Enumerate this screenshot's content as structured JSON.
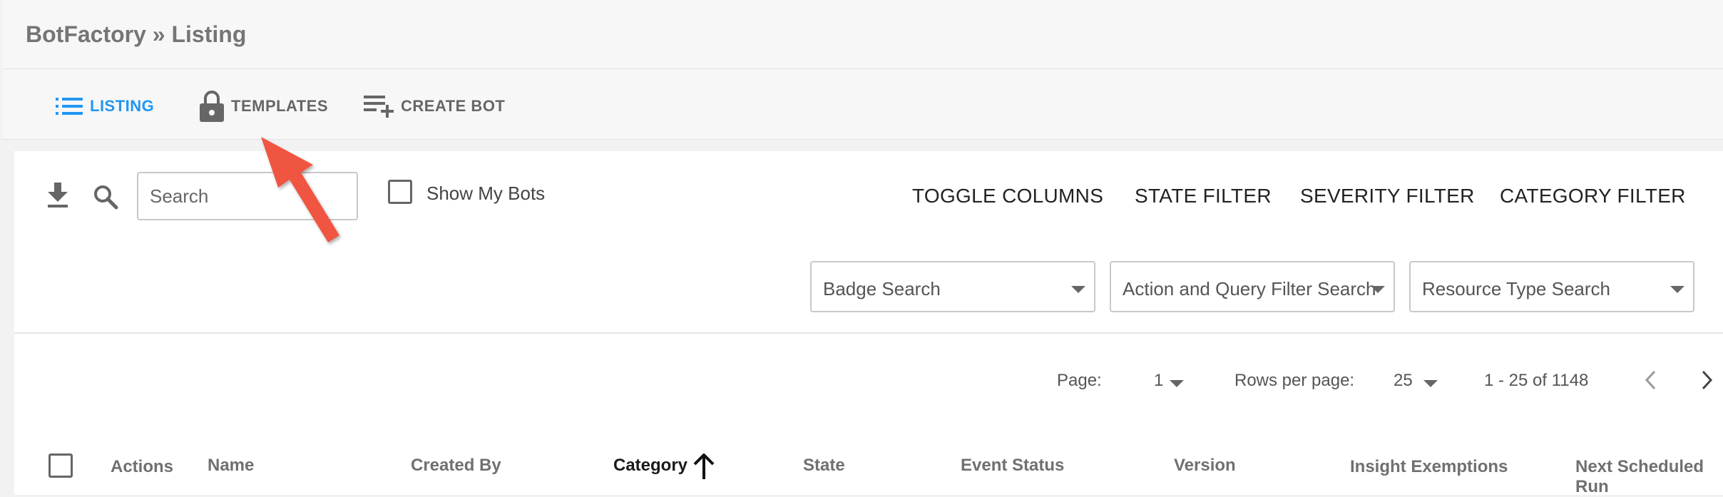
{
  "header": {
    "title": "BotFactory » Listing"
  },
  "nav": {
    "tabs": [
      {
        "label": "LISTING",
        "icon": "list-icon",
        "active": true
      },
      {
        "label": "TEMPLATES",
        "icon": "lock-icon",
        "active": false
      },
      {
        "label": "CREATE BOT",
        "icon": "playlist-add-icon",
        "active": false
      }
    ]
  },
  "toolbar": {
    "download_icon": "download-icon",
    "search_icon": "search-icon",
    "search_placeholder": "Search",
    "search_value": "",
    "show_my_bots_label": "Show My Bots",
    "show_my_bots_checked": false,
    "filters": [
      "TOGGLE COLUMNS",
      "STATE FILTER",
      "SEVERITY FILTER",
      "CATEGORY FILTER"
    ],
    "selects": [
      "Badge Search",
      "Action and Query Filter Search",
      "Resource Type Search"
    ]
  },
  "pagination": {
    "page_label": "Page:",
    "page_value": "1",
    "rows_label": "Rows per page:",
    "rows_value": "25",
    "range": "1 - 25 of 1148"
  },
  "table": {
    "columns": [
      "Actions",
      "Name",
      "Created By",
      "Category",
      "State",
      "Event Status",
      "Version",
      "Insight Exemptions",
      "Next Scheduled Run"
    ],
    "sorted_column": "Category",
    "sort_direction": "ascending"
  },
  "colors": {
    "accent": "#2196f3",
    "annotation_arrow": "#f05542",
    "muted_text": "#757575"
  }
}
